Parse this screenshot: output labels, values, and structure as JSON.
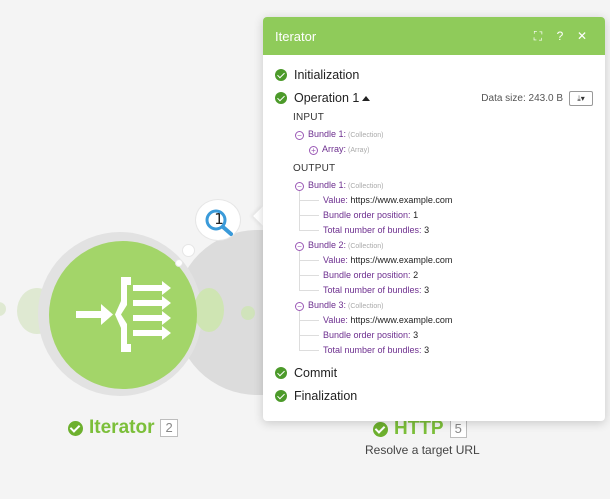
{
  "panel": {
    "title": "Iterator",
    "buttons": {
      "expand": "⛶",
      "help": "?",
      "close": "✕"
    },
    "steps": {
      "initialization": "Initialization",
      "operation": "Operation 1",
      "commit": "Commit",
      "finalization": "Finalization"
    },
    "data_size": "Data size: 243.0 B",
    "download_label": "⤓▾",
    "input": {
      "heading": "INPUT",
      "bundle": {
        "name": "Bundle 1:",
        "type": "(Collection)"
      },
      "array": {
        "name": "Array:",
        "type": "(Array)"
      }
    },
    "output": {
      "heading": "OUTPUT",
      "bundles": [
        {
          "name": "Bundle 1:",
          "type": "(Collection)",
          "value_key": "Value:",
          "value": "https://www.example.com",
          "pos_key": "Bundle order position:",
          "pos": "1",
          "total_key": "Total number of bundles:",
          "total": "3"
        },
        {
          "name": "Bundle 2:",
          "type": "(Collection)",
          "value_key": "Value:",
          "value": "https://www.example.com",
          "pos_key": "Bundle order position:",
          "pos": "2",
          "total_key": "Total number of bundles:",
          "total": "3"
        },
        {
          "name": "Bundle 3:",
          "type": "(Collection)",
          "value_key": "Value:",
          "value": "https://www.example.com",
          "pos_key": "Bundle order position:",
          "pos": "3",
          "total_key": "Total number of bundles:",
          "total": "3"
        }
      ]
    }
  },
  "canvas": {
    "bubble_count": "1",
    "iterator_module": {
      "name": "Iterator",
      "id": "2"
    },
    "http_module": {
      "name": "HTTP",
      "id": "5",
      "subtitle": "Resolve a target URL"
    }
  },
  "colors": {
    "accent": "#8fcb5a",
    "module": "#a3d569",
    "check": "#4c9a2a",
    "tree_key": "#6d2f8f"
  },
  "icons": {
    "iterator": "iterator-arrows-icon",
    "inspect": "magnifier-icon"
  }
}
